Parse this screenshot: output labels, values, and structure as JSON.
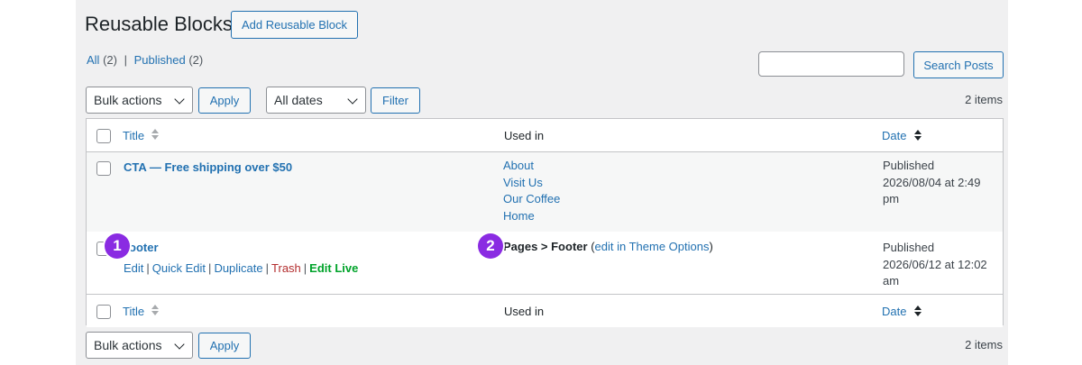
{
  "header": {
    "title": "Reusable Blocks",
    "add_button": "Add Reusable Block"
  },
  "views": {
    "all_label": "All",
    "all_count": "(2)",
    "separator": "|",
    "published_label": "Published",
    "published_count": "(2)"
  },
  "search": {
    "value": "",
    "button": "Search Posts"
  },
  "tablenav_top": {
    "bulk_actions": "Bulk actions",
    "apply": "Apply",
    "dates": "All dates",
    "filter": "Filter",
    "items": "2 items"
  },
  "tablenav_bottom": {
    "bulk_actions": "Bulk actions",
    "apply": "Apply",
    "items": "2 items"
  },
  "columns": {
    "title": "Title",
    "used_in": "Used in",
    "date": "Date"
  },
  "rows": [
    {
      "title": "CTA — Free shipping over $50",
      "used_in": [
        "About",
        "Visit Us",
        "Our Coffee",
        "Home"
      ],
      "date_status": "Published",
      "date_line1": "2026/08/04 at 2:49",
      "date_line2": "pm"
    },
    {
      "title": "Footer",
      "title_visible": "ooter",
      "actions": {
        "edit": "Edit",
        "quick_edit": "Quick Edit",
        "duplicate": "Duplicate",
        "trash": "Trash",
        "edit_live": "Edit Live",
        "separator": "|"
      },
      "used_in_text": "Pages > Footer",
      "used_in_link_open": "(",
      "used_in_link": "edit in Theme Options",
      "used_in_link_close": ")",
      "date_status": "Published",
      "date_line1": "2026/06/12 at 12:02",
      "date_line2": "am"
    }
  ],
  "badges": [
    "1",
    "2"
  ],
  "colors": {
    "link": "#2271b1",
    "trash": "#b32d2e",
    "edit_live": "#00a32a",
    "badge": "#8a2be2",
    "background": "#f0f0f1"
  }
}
